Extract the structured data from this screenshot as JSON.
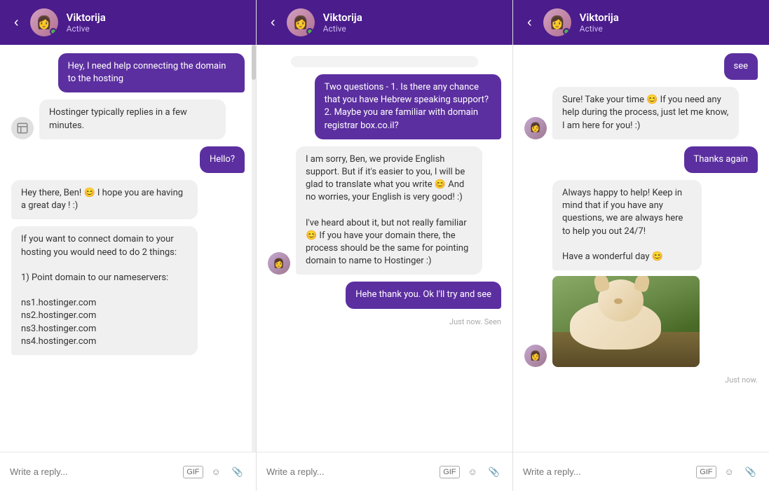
{
  "header": {
    "name": "Viktorija",
    "status": "Active",
    "back_label": "‹",
    "avatar_emoji": "👩"
  },
  "panels": [
    {
      "id": "panel1",
      "messages": [
        {
          "type": "sent",
          "text": "Hey, I need help connecting the domain to the hosting"
        },
        {
          "type": "received",
          "text": "Hostinger typically replies in a few minutes.",
          "has_icon": true
        },
        {
          "type": "sent",
          "text": "Hello?"
        },
        {
          "type": "received",
          "text": "Hey there, Ben! 😊 I hope you are having a great day ! :)",
          "has_icon": false
        },
        {
          "type": "received",
          "text": "If you want to connect domain to your hosting you would need to do 2 things:\n\n1) Point domain to our nameservers:\n\nns1.hostinger.com\nns2.hostinger.com\nns3.hostinger.com\nns4.hostinger.com",
          "has_icon": false
        }
      ],
      "input_placeholder": "Write a reply..."
    },
    {
      "id": "panel2",
      "messages": [
        {
          "type": "sent",
          "text": "Two questions - 1. Is there any chance that you have Hebrew speaking support?\n2. Maybe you are familiar with domain registrar box.co.il?"
        },
        {
          "type": "received",
          "text": "I am sorry, Ben, we provide English support. But if it's easier to you, I will be glad to translate what you write 😊 And no worries, your English is very good! :)\n\nI've heard about it, but not really familiar 😊 If you have your domain there, the process should be the same for pointing domain to name to Hostinger :)",
          "has_avatar": true
        },
        {
          "type": "sent",
          "text": "Hehe thank you. Ok I'll try and see"
        }
      ],
      "meta": "Just now. Seen",
      "input_placeholder": "Write a reply..."
    },
    {
      "id": "panel3",
      "messages": [
        {
          "type": "sent",
          "text": "see"
        },
        {
          "type": "received",
          "text": "Sure! Take your time 😊 If you need any help during the process, just let me know, I am here for you! :)",
          "has_avatar": true
        },
        {
          "type": "sent",
          "text": "Thanks again"
        },
        {
          "type": "received",
          "text": "Always happy to help! Keep in mind that if you have any questions, we are always here to help you out 24/7!\n\nHave a wonderful day 😊",
          "has_avatar": true,
          "has_image": true
        }
      ],
      "meta": "Just now.",
      "input_placeholder": "Write a reply..."
    }
  ],
  "input": {
    "gif_label": "GIF",
    "emoji_icon": "☺",
    "attach_icon": "📎"
  }
}
